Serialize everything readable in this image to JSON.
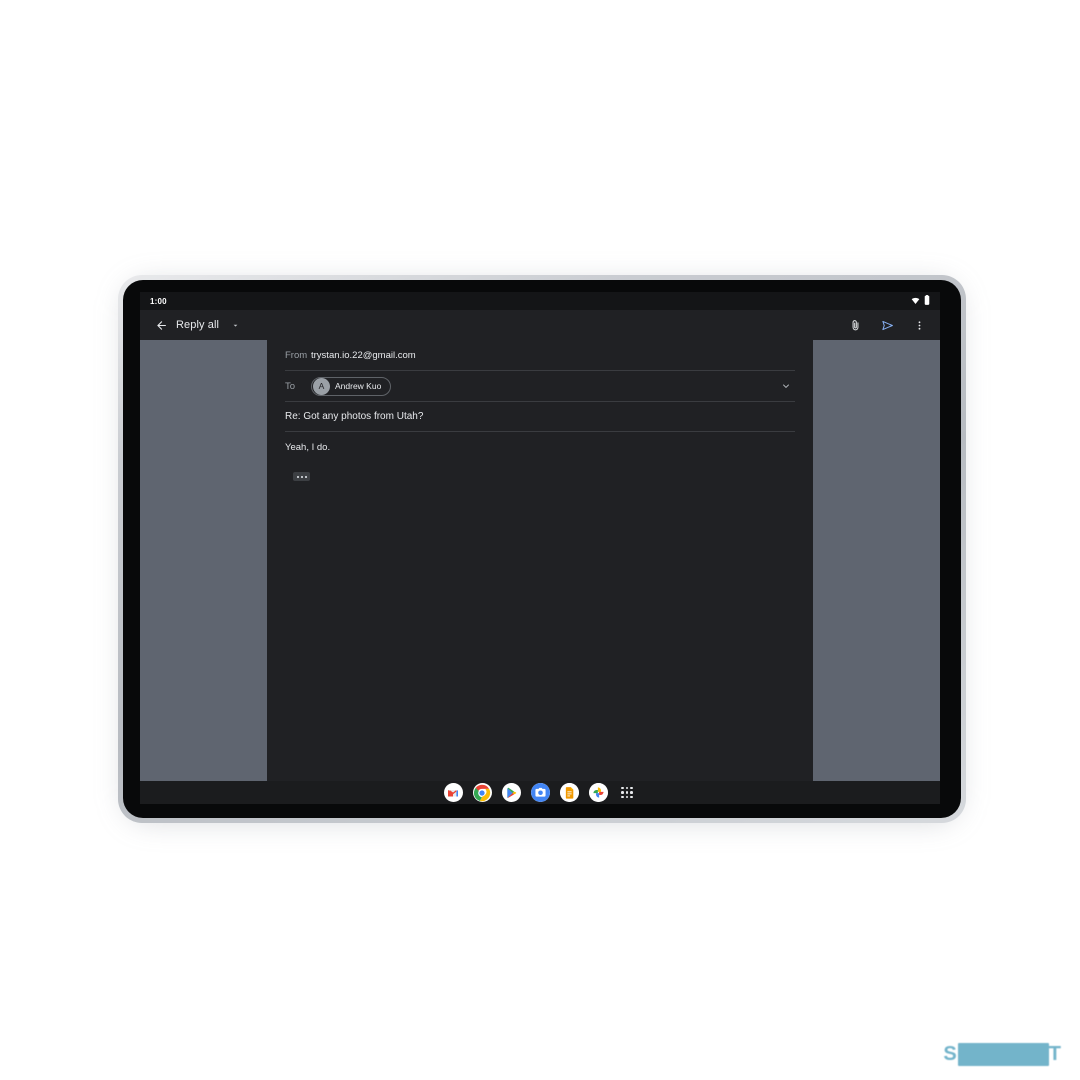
{
  "device": {
    "name": "android-tablet",
    "frame_color": "#c9ccd1",
    "bezel_color": "#08090a"
  },
  "status_bar": {
    "clock": "1:00",
    "icons": [
      "wifi-icon",
      "battery-icon"
    ]
  },
  "app_bar": {
    "back_icon": "back-arrow-icon",
    "title": "Reply all",
    "dropdown_icon": "caret-down-icon",
    "actions": [
      {
        "name": "attach-icon",
        "label": "Attach file"
      },
      {
        "name": "send-icon",
        "label": "Send"
      },
      {
        "name": "more-options-icon",
        "label": "More options"
      }
    ]
  },
  "compose": {
    "from": {
      "label": "From",
      "value": "trystan.io.22@gmail.com"
    },
    "to": {
      "label": "To",
      "recipients": [
        {
          "initial": "A",
          "name": "Andrew Kuo"
        }
      ],
      "expand_icon": "chevron-down-icon"
    },
    "subject": "Re: Got any photos from Utah?",
    "body": "Yeah, I do.",
    "quoted_toggle": "show-quoted-text"
  },
  "dock": {
    "items": [
      {
        "name": "gmail-icon",
        "label": "Gmail"
      },
      {
        "name": "chrome-icon",
        "label": "Chrome"
      },
      {
        "name": "play-store-icon",
        "label": "Play Store"
      },
      {
        "name": "camera-icon",
        "label": "Camera"
      },
      {
        "name": "keep-icon",
        "label": "Keep Notes"
      },
      {
        "name": "photos-icon",
        "label": "Photos"
      },
      {
        "name": "app-drawer-icon",
        "label": "All apps"
      }
    ]
  },
  "watermark": {
    "prefix": "S",
    "redacted": "██████",
    "suffix": "T"
  },
  "colors": {
    "surface": "#202124",
    "backdrop": "#5f6570",
    "status_bar": "#141517",
    "dock": "#1b1c1e",
    "text_primary": "#e8eaed",
    "text_secondary": "#9aa0a6",
    "divider": "#3a3c40",
    "send_accent": "#8ab4f8"
  }
}
